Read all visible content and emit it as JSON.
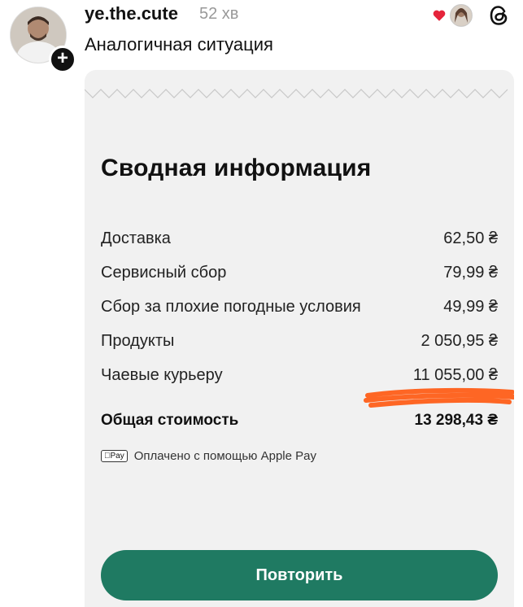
{
  "post": {
    "username": "ye.the.cute",
    "time": "52 хв",
    "text": "Аналогичная ситуация"
  },
  "icons": {
    "avatar": "user-avatar",
    "follow": "plus-icon",
    "like": "heart-icon",
    "liker": "liker-avatar",
    "app": "threads-icon",
    "apple_pay": "apple-pay-icon"
  },
  "receipt": {
    "title": "Сводная информация",
    "rows": [
      {
        "label": "Доставка",
        "value": "62,50 ₴"
      },
      {
        "label": "Сервисный сбор",
        "value": "79,99 ₴"
      },
      {
        "label": "Сбор за плохие погодные условия",
        "value": "49,99 ₴"
      },
      {
        "label": "Продукты",
        "value": "2 050,95 ₴"
      },
      {
        "label": "Чаевые курьеру",
        "value": "11 055,00 ₴"
      }
    ],
    "total_label": "Общая стоимость",
    "total_value": "13 298,43 ₴",
    "applepay_badge": "Pay",
    "paid_text": "Оплачено с помощью Apple Pay",
    "repeat_label": "Повторить"
  },
  "colors": {
    "accent": "#1f7a62",
    "scribble": "#ff5a12",
    "heart": "#e5243b"
  }
}
